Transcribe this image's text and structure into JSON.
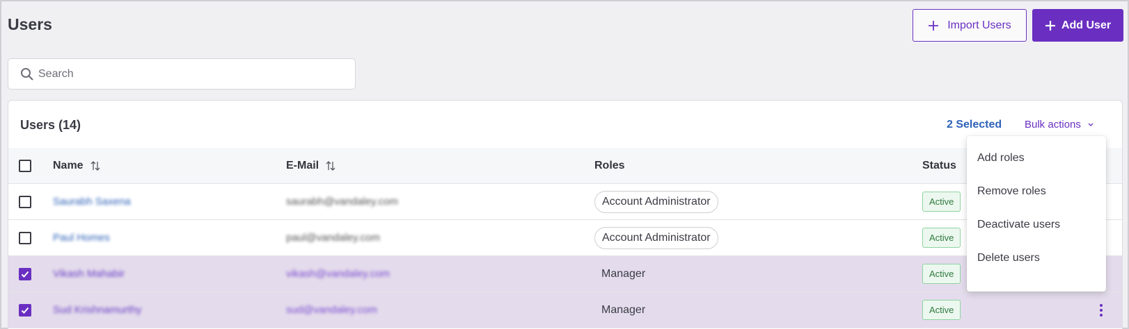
{
  "page": {
    "title": "Users"
  },
  "header": {
    "import_label": "Import Users",
    "add_label": "Add User"
  },
  "search": {
    "placeholder": "Search",
    "value": ""
  },
  "table": {
    "title": "Users (14)",
    "selected_label": "2 Selected",
    "bulk_actions_label": "Bulk actions",
    "columns": {
      "name": "Name",
      "email": "E-Mail",
      "roles": "Roles",
      "status": "Status"
    },
    "rows": [
      {
        "name": "Saurabh Saxena",
        "email": "saurabh@vandaley.com",
        "role": "Account Administrator",
        "status": "Active",
        "selected": false
      },
      {
        "name": "Paul Homes",
        "email": "paul@vandaley.com",
        "role": "Account Administrator",
        "status": "Active",
        "selected": false
      },
      {
        "name": "Vikash Mahabir",
        "email": "vikash@vandaley.com",
        "role": "Manager",
        "status": "Active",
        "selected": true
      },
      {
        "name": "Sud Krishnamurthy",
        "email": "sud@vandaley.com",
        "role": "Manager",
        "status": "Active",
        "selected": true
      }
    ]
  },
  "bulk_menu": {
    "items": [
      "Add roles",
      "Remove roles",
      "Deactivate users",
      "Delete users"
    ]
  },
  "colors": {
    "accent": "#6a2fc1",
    "link": "#2e62b8",
    "selected_row": "#e4dcec",
    "status_active_bg": "#ecf8ef",
    "status_active_border": "#8ed3a1"
  },
  "icons": {
    "import": "plus-icon",
    "add": "plus-icon",
    "search": "search-icon",
    "sort": "sort-arrows-icon",
    "bulk": "chevron-down-icon",
    "row_menu": "kebab-menu-icon"
  }
}
